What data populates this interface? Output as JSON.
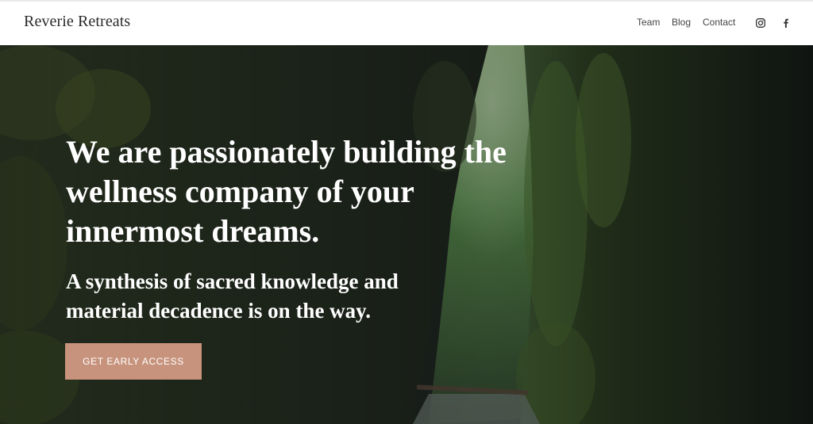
{
  "header": {
    "brand": "Reverie Retreats",
    "nav": [
      {
        "label": "Team"
      },
      {
        "label": "Blog"
      },
      {
        "label": "Contact"
      }
    ],
    "social": [
      {
        "icon": "instagram-icon"
      },
      {
        "icon": "facebook-icon"
      }
    ]
  },
  "hero": {
    "headline": "We are passionately building the wellness company of your innermost dreams.",
    "subheadline": "A synthesis of sacred knowledge and material decadence is on the way.",
    "cta_label": "GET EARLY ACCESS",
    "background": "forest-canyon-photo"
  },
  "colors": {
    "cta": "#c7937c",
    "header_bg": "#ffffff",
    "text_dark": "#2a2a2a",
    "hero_text": "#ffffff"
  }
}
